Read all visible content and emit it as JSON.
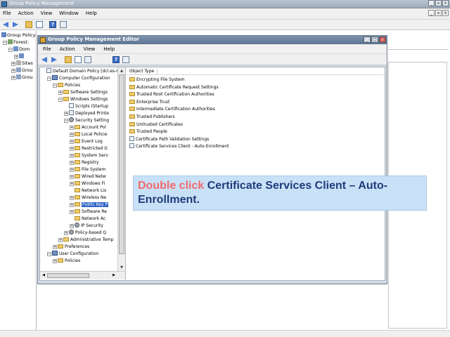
{
  "outer": {
    "title": "Group Policy Management",
    "menu": [
      "File",
      "Action",
      "View",
      "Window",
      "Help"
    ],
    "tree": [
      "Group Policy",
      "Forest:",
      "Dom",
      "Sites",
      "Grou",
      "Grou"
    ]
  },
  "editor": {
    "title": "Group Policy Management Editor",
    "menu": [
      "File",
      "Action",
      "View",
      "Help"
    ],
    "tree": [
      {
        "label": "Default Domain Policy [dcl.es-n",
        "indent": 0,
        "icon": "doc",
        "exp": ""
      },
      {
        "label": "Computer Configuration",
        "indent": 1,
        "icon": "pc",
        "exp": "−"
      },
      {
        "label": "Policies",
        "indent": 2,
        "icon": "folder",
        "exp": "−"
      },
      {
        "label": "Software Settings",
        "indent": 3,
        "icon": "folder",
        "exp": "+"
      },
      {
        "label": "Windows Settings",
        "indent": 3,
        "icon": "folder",
        "exp": "−"
      },
      {
        "label": "Scripts (Startup",
        "indent": 4,
        "icon": "doc",
        "exp": ""
      },
      {
        "label": "Deployed Printe",
        "indent": 4,
        "icon": "doc",
        "exp": "+"
      },
      {
        "label": "Security Setting",
        "indent": 4,
        "icon": "gear",
        "exp": "−"
      },
      {
        "label": "Account Pol",
        "indent": 5,
        "icon": "folder",
        "exp": "+"
      },
      {
        "label": "Local Policie",
        "indent": 5,
        "icon": "folder",
        "exp": "+"
      },
      {
        "label": "Event Log",
        "indent": 5,
        "icon": "folder",
        "exp": "+"
      },
      {
        "label": "Restricted G",
        "indent": 5,
        "icon": "folder",
        "exp": "+"
      },
      {
        "label": "System Serv",
        "indent": 5,
        "icon": "folder",
        "exp": "+"
      },
      {
        "label": "Registry",
        "indent": 5,
        "icon": "folder",
        "exp": "+"
      },
      {
        "label": "File System",
        "indent": 5,
        "icon": "folder",
        "exp": "+"
      },
      {
        "label": "Wired Netw",
        "indent": 5,
        "icon": "folder",
        "exp": "+"
      },
      {
        "label": "Windows Fi",
        "indent": 5,
        "icon": "folder",
        "exp": "+"
      },
      {
        "label": "Network Lis",
        "indent": 5,
        "icon": "folder",
        "exp": ""
      },
      {
        "label": "Wireless Ne",
        "indent": 5,
        "icon": "folder",
        "exp": "+"
      },
      {
        "label": "Public Key P",
        "indent": 5,
        "icon": "folder",
        "exp": "+",
        "selected": true
      },
      {
        "label": "Software Re",
        "indent": 5,
        "icon": "folder",
        "exp": "+"
      },
      {
        "label": "Network Ac",
        "indent": 5,
        "icon": "folder",
        "exp": ""
      },
      {
        "label": "IP Security",
        "indent": 5,
        "icon": "gear",
        "exp": "+"
      },
      {
        "label": "Policy-based Q",
        "indent": 4,
        "icon": "gear",
        "exp": "+"
      },
      {
        "label": "Administrative Temp",
        "indent": 3,
        "icon": "folder",
        "exp": "+"
      },
      {
        "label": "Preferences",
        "indent": 2,
        "icon": "folder",
        "exp": "+"
      },
      {
        "label": "User Configuration",
        "indent": 1,
        "icon": "pc",
        "exp": "−"
      },
      {
        "label": "Policies",
        "indent": 2,
        "icon": "folder",
        "exp": "+"
      }
    ],
    "list_header": "Object Type",
    "list_items": [
      {
        "label": "Encrypting File System",
        "icon": "folder"
      },
      {
        "label": "Automatic Certificate Request Settings",
        "icon": "folder"
      },
      {
        "label": "Trusted Root Certification Authorities",
        "icon": "folder"
      },
      {
        "label": "Enterprise Trust",
        "icon": "folder"
      },
      {
        "label": "Intermediate Certification Authorities",
        "icon": "folder"
      },
      {
        "label": "Trusted Publishers",
        "icon": "folder"
      },
      {
        "label": "Untrusted Certificates",
        "icon": "folder"
      },
      {
        "label": "Trusted People",
        "icon": "folder"
      },
      {
        "label": "Certificate Path Validation Settings",
        "icon": "doc"
      },
      {
        "label": "Certificate Services Client - Auto-Enrollment",
        "icon": "doc"
      }
    ]
  },
  "callout": {
    "action": "Double click",
    "target": "Certificate Services Client – Auto-Enrollment."
  },
  "colors": {
    "callout_bg": "#c9e1f7",
    "callout_action": "#f16b6b",
    "callout_target": "#1f3a7a",
    "selection": "#3165c5"
  }
}
